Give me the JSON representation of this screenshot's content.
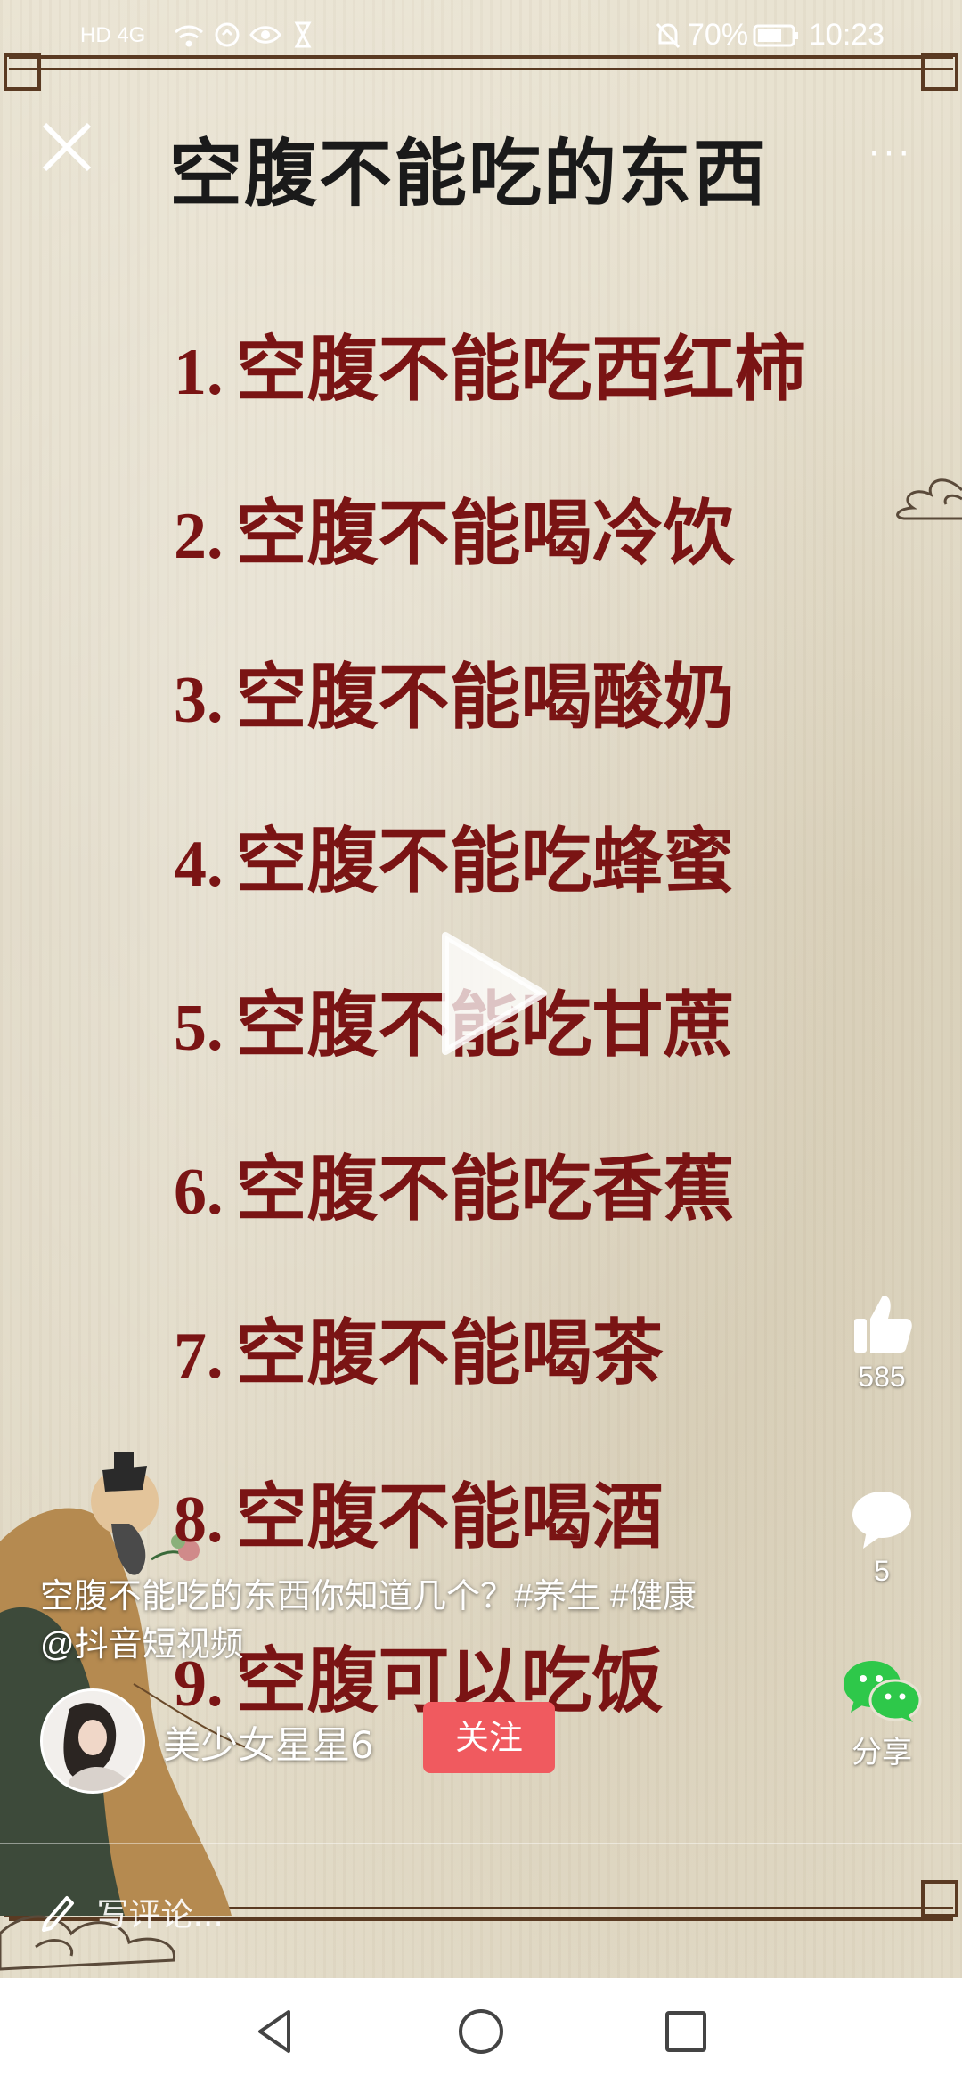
{
  "status_bar": {
    "network": "HD 4G",
    "battery": "70%",
    "time": "10:23"
  },
  "header": {
    "title": "空腹不能吃的东西",
    "more_label": "···"
  },
  "tips": [
    {
      "num": "1.",
      "text": "空腹不能吃西红柿"
    },
    {
      "num": "2.",
      "text": "空腹不能喝冷饮"
    },
    {
      "num": "3.",
      "text": "空腹不能喝酸奶"
    },
    {
      "num": "4.",
      "text": "空腹不能吃蜂蜜"
    },
    {
      "num": "5.",
      "text": "空腹不能吃甘蔗"
    },
    {
      "num": "6.",
      "text": "空腹不能吃香蕉"
    },
    {
      "num": "7.",
      "text": "空腹不能喝茶"
    },
    {
      "num": "8.",
      "text": "空腹不能喝酒"
    },
    {
      "num": "9.",
      "text": "空腹可以吃饭"
    }
  ],
  "actions": {
    "like_count": "585",
    "comment_count": "5",
    "share_label": "分享"
  },
  "post": {
    "caption_line1": "空腹不能吃的东西你知道几个？#养生 #健康",
    "caption_line2": "@抖音短视频",
    "author": "美少女星星6",
    "follow_label": "关注"
  },
  "comment": {
    "placeholder": "写评论..."
  },
  "colors": {
    "title": "#1a1a1a",
    "tip_text": "#7a1414",
    "follow_button": "#f05a5f",
    "wechat_green": "#2ec84a"
  }
}
